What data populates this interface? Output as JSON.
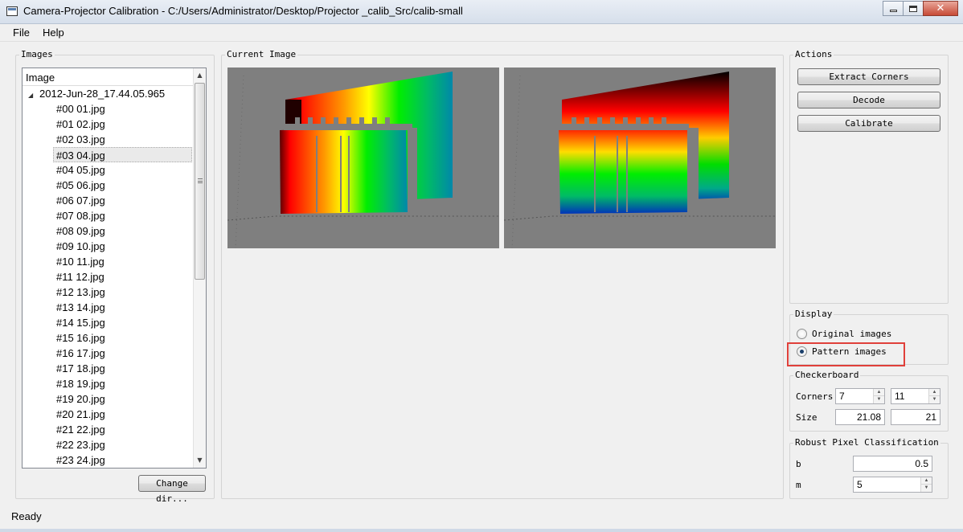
{
  "window": {
    "title": "Camera-Projector Calibration - C:/Users/Administrator/Desktop/Projector _calib_Src/calib-small",
    "controls": {
      "minimize": "–",
      "maximize": "□",
      "close": "✕"
    }
  },
  "menu": {
    "items": [
      "File",
      "Help"
    ]
  },
  "images_panel": {
    "title": "Images",
    "tree_header": "Image",
    "root": "2012-Jun-28_17.44.05.965",
    "selected_index": 3,
    "items": [
      "#00 01.jpg",
      "#01 02.jpg",
      "#02 03.jpg",
      "#03 04.jpg",
      "#04 05.jpg",
      "#05 06.jpg",
      "#06 07.jpg",
      "#07 08.jpg",
      "#08 09.jpg",
      "#09 10.jpg",
      "#10 11.jpg",
      "#11 12.jpg",
      "#12 13.jpg",
      "#13 14.jpg",
      "#14 15.jpg",
      "#15 16.jpg",
      "#16 17.jpg",
      "#17 18.jpg",
      "#18 19.jpg",
      "#19 20.jpg",
      "#20 21.jpg",
      "#21 22.jpg",
      "#22 23.jpg",
      "#23 24.jpg"
    ],
    "change_dir_label": "Change dir..."
  },
  "current_image": {
    "title": "Current Image",
    "background_color": "#7f7f7f"
  },
  "actions": {
    "title": "Actions",
    "buttons": [
      "Extract Corners",
      "Decode",
      "Calibrate"
    ]
  },
  "display": {
    "title": "Display",
    "options": [
      "Original images",
      "Pattern images"
    ],
    "selected": "Pattern images",
    "highlight_color": "#e0403a"
  },
  "checkerboard": {
    "title": "Checkerboard",
    "corners_label": "Corners",
    "corners_x": "7",
    "corners_y": "11",
    "size_label": "Size",
    "size_x": "21.08",
    "size_y": "21"
  },
  "robust": {
    "title": "Robust Pixel Classification",
    "b_label": "b",
    "b_value": "0.5",
    "m_label": "m",
    "m_value": "5"
  },
  "status": {
    "text": "Ready"
  }
}
